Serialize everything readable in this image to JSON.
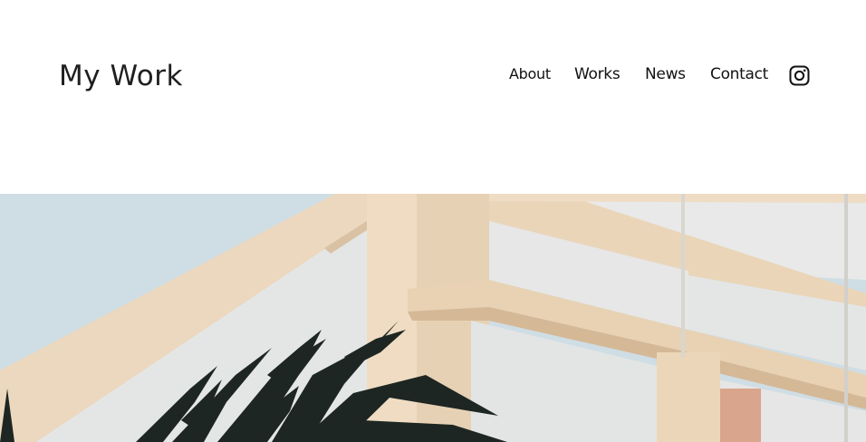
{
  "header": {
    "title": "My Work"
  },
  "nav": {
    "items": [
      "About",
      "Works",
      "News",
      "Contact"
    ],
    "social_icon": "instagram-icon"
  },
  "hero": {
    "image_subject": "building-corner-with-palm",
    "colors": {
      "sky": "#cfdde4",
      "wall_cream": "#ecd7bd",
      "wall_shadow": "#d8bf9e",
      "panel_white": "#e6e7e6",
      "palm": "#1d2622"
    }
  }
}
